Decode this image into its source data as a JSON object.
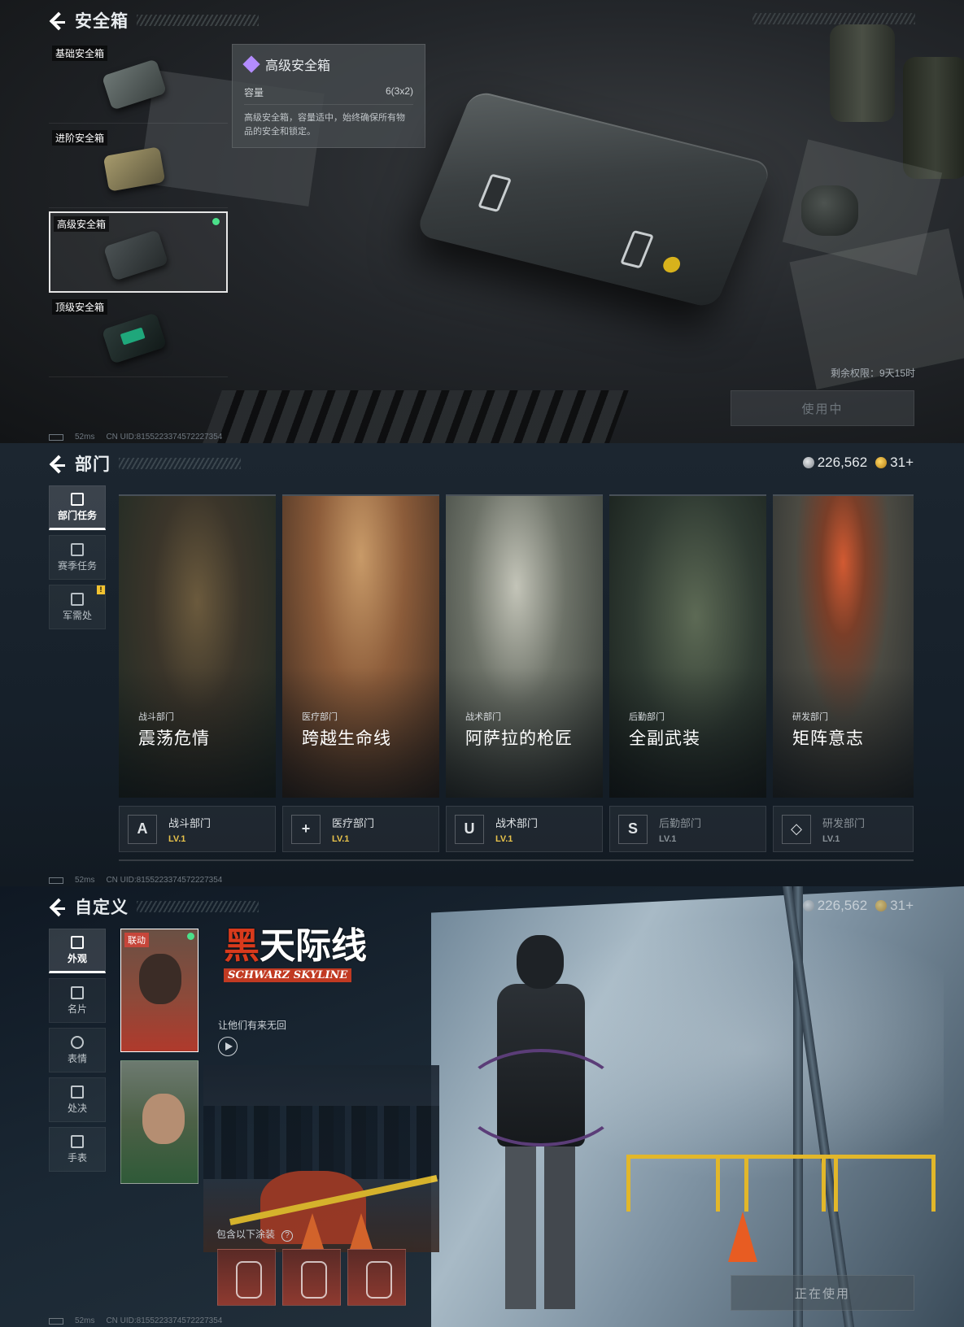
{
  "safebox": {
    "title": "安全箱",
    "boxes": [
      {
        "label": "基础安全箱",
        "color": "#6d7775"
      },
      {
        "label": "进阶安全箱",
        "color": "#a69a6c"
      },
      {
        "label": "高级安全箱",
        "color": "#4b5254",
        "selected": true
      },
      {
        "label": "顶级安全箱",
        "color": "#1fa77b"
      }
    ],
    "tooltip": {
      "name": "高级安全箱",
      "capacity_label": "容量",
      "capacity_value": "6(3x2)",
      "description": "高级安全箱，容量适中，始终确保所有物品的安全和锁定。"
    },
    "remaining": "剩余权限：9天15时",
    "action_button": "使用中",
    "status": {
      "ping": "52ms",
      "uid": "CN UID:8155223374572227354"
    }
  },
  "departments": {
    "title": "部门",
    "currency": {
      "silver": "226,562",
      "gold": "31+"
    },
    "tabs": [
      {
        "label": "部门任务",
        "icon": "task-icon",
        "active": true
      },
      {
        "label": "赛季任务",
        "icon": "season-icon"
      },
      {
        "label": "军需处",
        "icon": "supply-icon",
        "badge": "!"
      }
    ],
    "cards": [
      {
        "sub": "战斗部门",
        "name": "震荡危情"
      },
      {
        "sub": "医疗部门",
        "name": "跨越生命线"
      },
      {
        "sub": "战术部门",
        "name": "阿萨拉的枪匠"
      },
      {
        "sub": "后勤部门",
        "name": "全副武装"
      },
      {
        "sub": "研发部门",
        "name": "矩阵意志"
      }
    ],
    "levels": [
      {
        "name": "战斗部门",
        "level": "LV.1",
        "glyph": "A"
      },
      {
        "name": "医疗部门",
        "level": "LV.1",
        "glyph": "+"
      },
      {
        "name": "战术部门",
        "level": "LV.1",
        "glyph": "U"
      },
      {
        "name": "后勤部门",
        "level": "LV.1",
        "glyph": "S"
      },
      {
        "name": "研发部门",
        "level": "LV.1",
        "glyph": "◇"
      }
    ],
    "status": {
      "ping": "52ms",
      "uid": "CN UID:8155223374572227354"
    }
  },
  "customize": {
    "title": "自定义",
    "currency": {
      "silver": "226,562",
      "gold": "31+"
    },
    "tabs": [
      {
        "label": "外观",
        "icon": "outfit-icon",
        "active": true
      },
      {
        "label": "名片",
        "icon": "card-icon"
      },
      {
        "label": "表情",
        "icon": "emote-icon"
      },
      {
        "label": "处决",
        "icon": "execution-icon"
      },
      {
        "label": "手表",
        "icon": "watch-icon"
      }
    ],
    "collab_badge": "联动",
    "skin_title_red": "黑",
    "skin_title_rest": "天际线",
    "skin_title_en": "SCHWARZ SKYLINE",
    "tagline": "让他们有来无回",
    "includes_label": "包含以下涂装",
    "action_button": "正在使用",
    "status": {
      "ping": "52ms",
      "uid": "CN UID:8155223374572227354"
    }
  }
}
